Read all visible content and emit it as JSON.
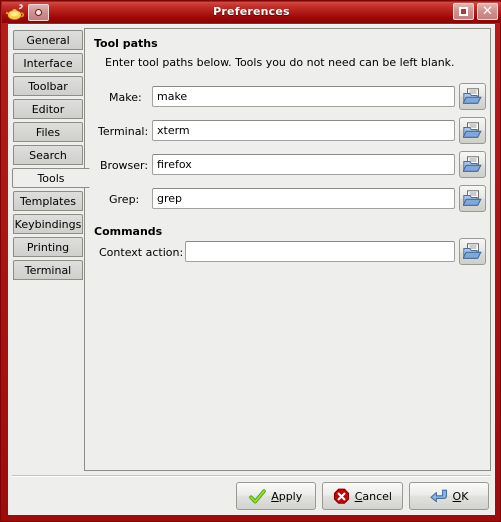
{
  "window": {
    "title": "Preferences",
    "app_icon": "geany-lamp-icon",
    "menu_button_icon": "window-menu-icon",
    "maximize_icon": "maximize-icon",
    "close_icon": "close-icon",
    "titlebar_color": "#ad1512",
    "border_color": "#9e0b0b"
  },
  "sidebar": {
    "items": [
      {
        "label": "General",
        "selected": false
      },
      {
        "label": "Interface",
        "selected": false
      },
      {
        "label": "Toolbar",
        "selected": false
      },
      {
        "label": "Editor",
        "selected": false
      },
      {
        "label": "Files",
        "selected": false
      },
      {
        "label": "Search",
        "selected": false
      },
      {
        "label": "Tools",
        "selected": true
      },
      {
        "label": "Templates",
        "selected": false
      },
      {
        "label": "Keybindings",
        "selected": false
      },
      {
        "label": "Printing",
        "selected": false
      },
      {
        "label": "Terminal",
        "selected": false
      }
    ]
  },
  "page": {
    "tool_paths": {
      "title": "Tool paths",
      "description": "Enter tool paths below. Tools you do not need can be left blank.",
      "fields": [
        {
          "label": "Make:",
          "value": "make",
          "placeholder": "",
          "browse_icon": "open-folder-icon"
        },
        {
          "label": "Terminal:",
          "value": "xterm",
          "placeholder": "",
          "browse_icon": "open-folder-icon"
        },
        {
          "label": "Browser:",
          "value": "firefox",
          "placeholder": "",
          "browse_icon": "open-folder-icon"
        },
        {
          "label": "Grep:",
          "value": "grep",
          "placeholder": "",
          "browse_icon": "open-folder-icon"
        }
      ]
    },
    "commands": {
      "title": "Commands",
      "fields": [
        {
          "label": "Context action:",
          "value": "",
          "placeholder": "",
          "browse_icon": "open-folder-icon"
        }
      ]
    }
  },
  "actions": {
    "apply": {
      "label_pre": "",
      "mnemonic": "A",
      "label_post": "pply",
      "icon": "check-icon",
      "icon_color": "#72bf3c"
    },
    "cancel": {
      "label_pre": "",
      "mnemonic": "C",
      "label_post": "ancel",
      "icon": "stop-icon",
      "icon_color": "#cc0000"
    },
    "ok": {
      "label_pre": "",
      "mnemonic": "O",
      "label_post": "K",
      "icon": "enter-arrow-icon",
      "icon_color": "#6f9fd8"
    }
  }
}
